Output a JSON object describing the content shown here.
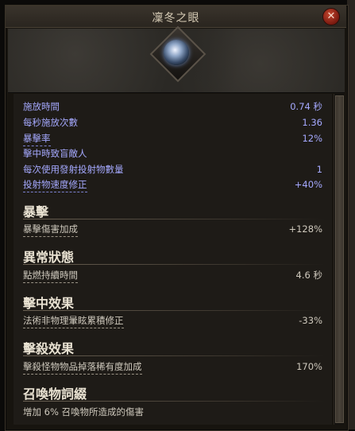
{
  "window": {
    "title": "凜冬之眼",
    "close_symbol": "✕"
  },
  "stats": [
    {
      "label": "施放時間",
      "value": "0.74 秒"
    },
    {
      "label": "每秒施放次數",
      "value": "1.36"
    },
    {
      "label": "暴擊率",
      "value": "12%"
    },
    {
      "label": "擊中時致盲敵人",
      "value": ""
    },
    {
      "label": "每次使用發射投射物數量",
      "value": "1"
    },
    {
      "label": "投射物速度修正",
      "value": "+40%"
    }
  ],
  "sections": [
    {
      "title": "暴擊",
      "row": {
        "label": "暴擊傷害加成",
        "value": "+128%"
      }
    },
    {
      "title": "異常狀態",
      "row": {
        "label": "點燃持續時間",
        "value": "4.6 秒"
      }
    },
    {
      "title": "擊中效果",
      "row": {
        "label": "法術非物理暈眩累積修正",
        "value": "-33%"
      }
    },
    {
      "title": "擊殺效果",
      "row": {
        "label": "擊殺怪物物品掉落稀有度加成",
        "value": "170%"
      }
    },
    {
      "title": "召喚物詞綴",
      "row": {
        "label": "增加 6% 召喚物所造成的傷害",
        "value": ""
      }
    }
  ],
  "icons": {
    "gem": "frost-eye-gem-icon",
    "close": "close-icon"
  }
}
